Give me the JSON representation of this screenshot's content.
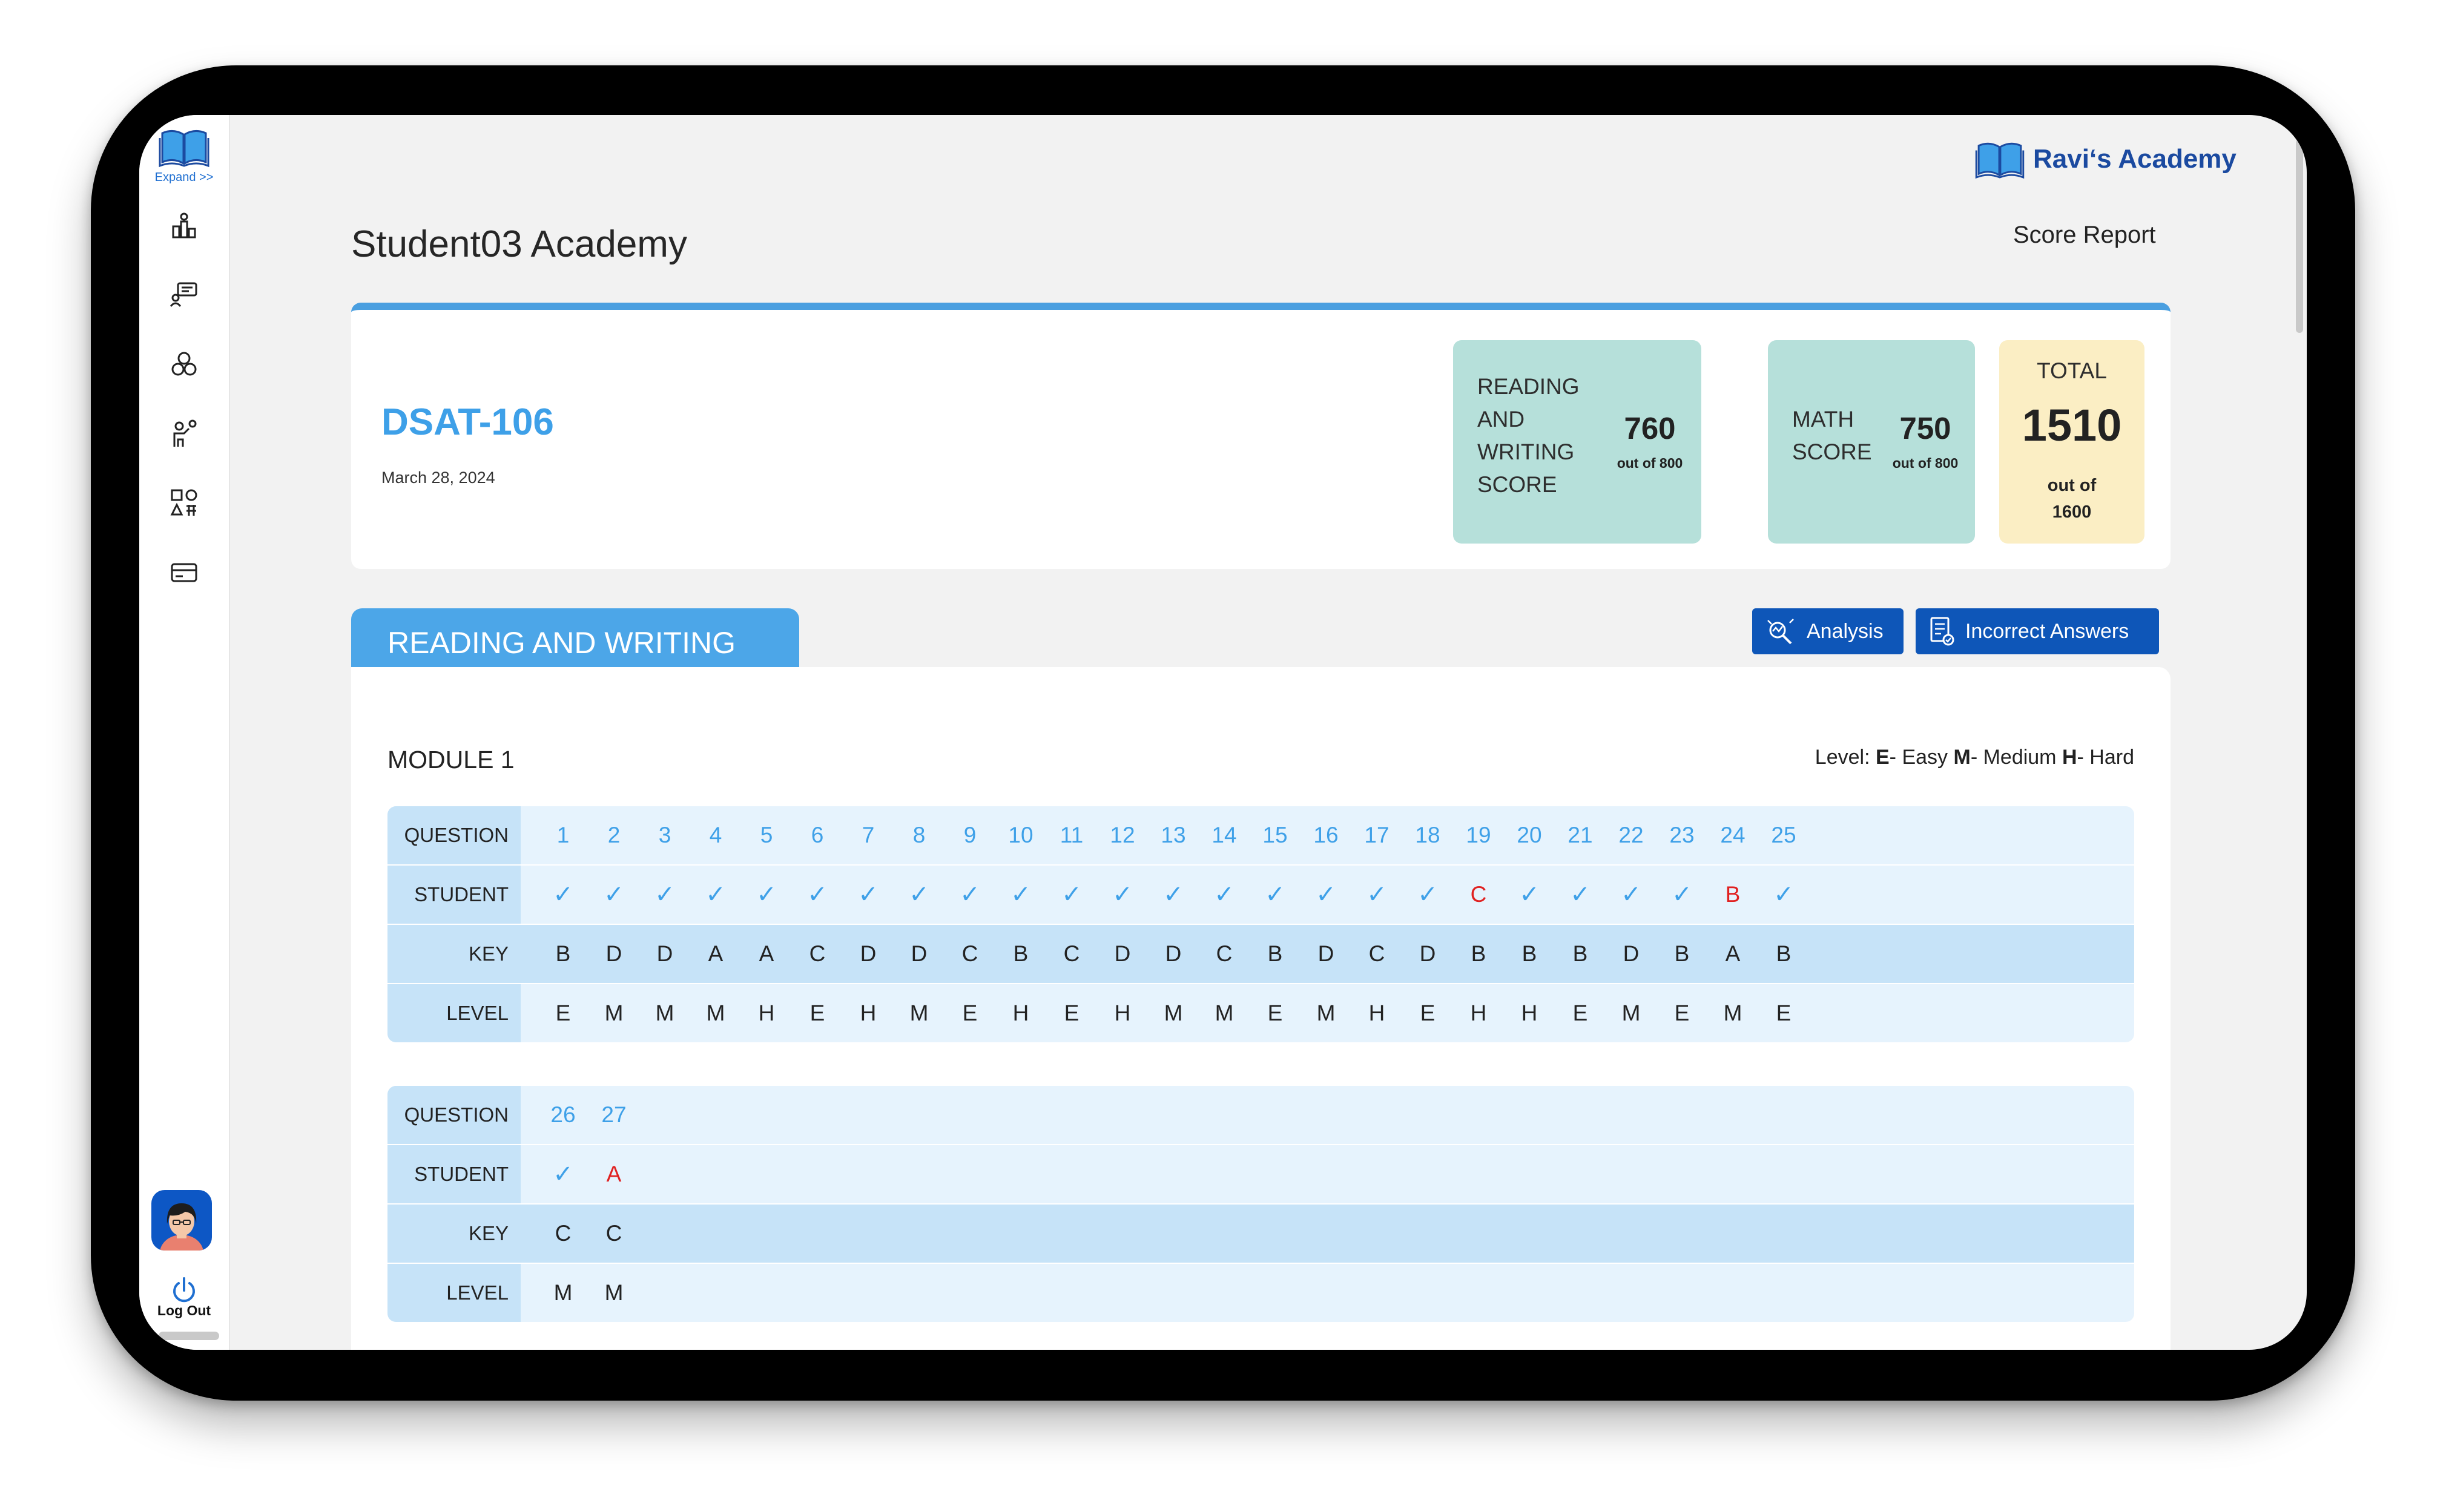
{
  "sidebar": {
    "expand_label": "Expand >>",
    "icons": [
      "dashboard-icon",
      "chat-icon",
      "modules-icon",
      "teacher-icon",
      "shapes-icon",
      "card-icon"
    ],
    "logout_label": "Log Out"
  },
  "header": {
    "brand": "Ravi‘s Academy",
    "student_name": "Student03 Academy",
    "report_label": "Score Report"
  },
  "test": {
    "name": "DSAT-106",
    "date": "March 28, 2024",
    "rw": {
      "label_lines": [
        "READING",
        "AND",
        "WRITING",
        "SCORE"
      ],
      "value": "760",
      "out_of": "out of 800"
    },
    "math": {
      "label_lines": [
        "MATH",
        "SCORE"
      ],
      "value": "750",
      "out_of": "out of 800"
    },
    "total": {
      "label": "TOTAL",
      "value": "1510",
      "out_of_lines": [
        "out of",
        "1600"
      ]
    }
  },
  "section": {
    "tab_label": "READING AND WRITING",
    "analysis_button": "Analysis",
    "incorrect_button": "Incorrect Answers"
  },
  "module": {
    "title": "MODULE 1",
    "legend": {
      "prefix": "Level:",
      "e_key": "E",
      "e_text": "- Easy",
      "m_key": "M",
      "m_text": "- Medium",
      "h_key": "H",
      "h_text": "- Hard"
    },
    "row_headers": {
      "question": "QUESTION",
      "student": "STUDENT",
      "key": "KEY",
      "level": "LEVEL"
    },
    "correct_mark": "✓",
    "tables": [
      {
        "questions": [
          "1",
          "2",
          "3",
          "4",
          "5",
          "6",
          "7",
          "8",
          "9",
          "10",
          "11",
          "12",
          "13",
          "14",
          "15",
          "16",
          "17",
          "18",
          "19",
          "20",
          "21",
          "22",
          "23",
          "24",
          "25"
        ],
        "student": [
          "✓",
          "✓",
          "✓",
          "✓",
          "✓",
          "✓",
          "✓",
          "✓",
          "✓",
          "✓",
          "✓",
          "✓",
          "✓",
          "✓",
          "✓",
          "✓",
          "✓",
          "✓",
          "C",
          "✓",
          "✓",
          "✓",
          "✓",
          "B",
          "✓"
        ],
        "key": [
          "B",
          "D",
          "D",
          "A",
          "A",
          "C",
          "D",
          "D",
          "C",
          "B",
          "C",
          "D",
          "D",
          "C",
          "B",
          "D",
          "C",
          "D",
          "B",
          "B",
          "B",
          "D",
          "B",
          "A",
          "B"
        ],
        "level": [
          "E",
          "M",
          "M",
          "M",
          "H",
          "E",
          "H",
          "M",
          "E",
          "H",
          "E",
          "H",
          "M",
          "M",
          "E",
          "M",
          "H",
          "E",
          "H",
          "H",
          "E",
          "M",
          "E",
          "M",
          "E"
        ]
      },
      {
        "questions": [
          "26",
          "27"
        ],
        "student": [
          "✓",
          "A"
        ],
        "key": [
          "C",
          "C"
        ],
        "level": [
          "M",
          "M"
        ]
      }
    ]
  },
  "colors": {
    "accent": "#4a9fe0",
    "brand": "#1b4aa0",
    "button": "#0e56b8",
    "wrong": "#e02020",
    "rw_box": "#b6e0da",
    "total_box": "#fbeec4"
  }
}
